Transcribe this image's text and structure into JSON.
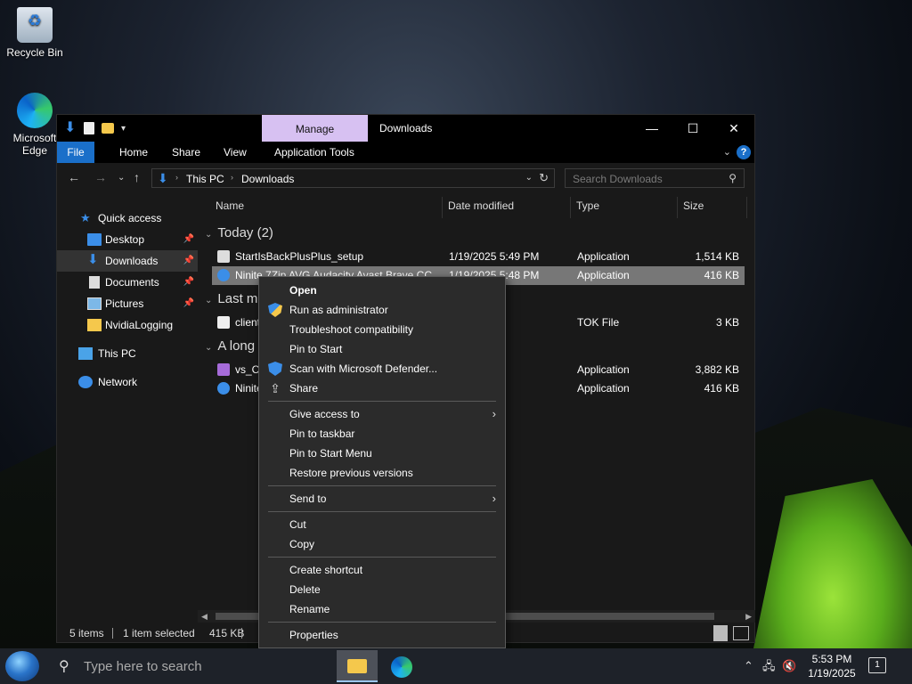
{
  "desktop": {
    "icons": [
      {
        "label": "Recycle Bin",
        "icon": "recycle-bin-icon"
      },
      {
        "label": "Microsoft Edge",
        "label_line1": "Microsoft",
        "label_line2": "Edge",
        "icon": "edge-icon"
      }
    ]
  },
  "window": {
    "title": "Downloads",
    "manage_tab": "Manage",
    "colors": {
      "manage_tab_bg": "#d7c1f2",
      "file_tab_bg": "#1a6fc9",
      "accent": "#3b8ee8"
    },
    "ribbon_tabs": [
      "File",
      "Home",
      "Share",
      "View",
      "Application Tools"
    ],
    "address": {
      "parts": [
        "This PC",
        "Downloads"
      ]
    },
    "search_placeholder": "Search Downloads"
  },
  "sidebar": {
    "items": [
      {
        "label": "Quick access",
        "icon": "star-icon"
      },
      {
        "label": "Desktop",
        "icon": "desktop-icon",
        "pinned": true
      },
      {
        "label": "Downloads",
        "icon": "download-icon",
        "pinned": true,
        "selected": true
      },
      {
        "label": "Documents",
        "icon": "documents-icon",
        "pinned": true
      },
      {
        "label": "Pictures",
        "icon": "pictures-icon",
        "pinned": true
      },
      {
        "label": "NvidiaLogging",
        "icon": "folder-icon"
      },
      {
        "label": "This PC",
        "icon": "this-pc-icon"
      },
      {
        "label": "Network",
        "icon": "network-icon"
      }
    ]
  },
  "columns": [
    "Name",
    "Date modified",
    "Type",
    "Size"
  ],
  "groups": [
    {
      "label": "Today (2)",
      "rows": [
        {
          "name": "StartIsBackPlusPlus_setup",
          "date": "1/19/2025 5:49 PM",
          "type": "Application",
          "size": "1,514 KB"
        },
        {
          "name": "Ninite 7Zip AVG Audacity Avast Brave CC...",
          "date": "1/19/2025 5:48 PM",
          "type": "Application",
          "size": "416 KB",
          "selected": true
        }
      ]
    },
    {
      "label": "Last m",
      "rows": [
        {
          "name": "client",
          "date": ":07 PM",
          "type": "TOK File",
          "size": "3 KB"
        }
      ]
    },
    {
      "label": "A long",
      "rows": [
        {
          "name": "vs_Co",
          "date": ":47 PM",
          "type": "Application",
          "size": "3,882 KB"
        },
        {
          "name": "Ninite",
          "date": ":42 PM",
          "type": "Application",
          "size": "416 KB"
        }
      ]
    }
  ],
  "status": {
    "items": "5 items",
    "selected": "1 item selected",
    "size": "415 KB"
  },
  "context_menu": {
    "items": [
      {
        "label": "Open",
        "bold": true
      },
      {
        "label": "Run as administrator",
        "icon": "uac-shield-icon"
      },
      {
        "label": "Troubleshoot compatibility"
      },
      {
        "label": "Pin to Start"
      },
      {
        "label": "Scan with Microsoft Defender...",
        "icon": "defender-icon"
      },
      {
        "label": "Share",
        "icon": "share-icon"
      },
      {
        "label": "Give access to",
        "submenu": true
      },
      {
        "label": "Pin to taskbar"
      },
      {
        "label": "Pin to Start Menu"
      },
      {
        "label": "Restore previous versions"
      },
      {
        "label": "Send to",
        "submenu": true
      },
      {
        "label": "Cut"
      },
      {
        "label": "Copy"
      },
      {
        "label": "Create shortcut"
      },
      {
        "label": "Delete"
      },
      {
        "label": "Rename"
      },
      {
        "label": "Properties"
      }
    ]
  },
  "taskbar": {
    "search_placeholder": "Type here to search",
    "time": "5:53 PM",
    "date": "1/19/2025",
    "notification_count": "1"
  }
}
